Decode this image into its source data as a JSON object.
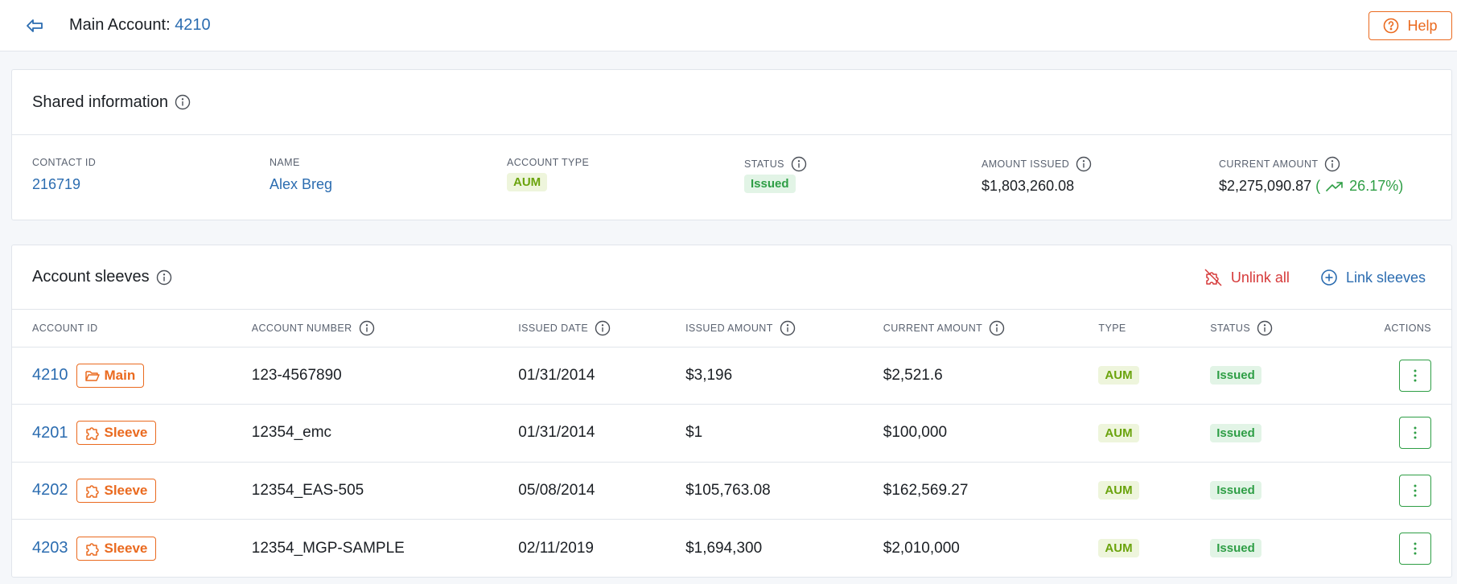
{
  "header": {
    "title_prefix": "Main Account: ",
    "account_number": "4210",
    "help_label": "Help"
  },
  "shared": {
    "title": "Shared information",
    "fields": {
      "contact_id": {
        "label": "CONTACT ID",
        "value": "216719"
      },
      "name": {
        "label": "NAME",
        "value": "Alex Breg"
      },
      "account_type": {
        "label": "ACCOUNT TYPE",
        "value": "AUM"
      },
      "status": {
        "label": "STATUS",
        "value": "Issued"
      },
      "amount_issued": {
        "label": "AMOUNT ISSUED",
        "value": "$1,803,260.08"
      },
      "current_amount": {
        "label": "CURRENT AMOUNT",
        "value": "$2,275,090.87",
        "pct_open": "(",
        "pct_value": "26.17%)"
      }
    }
  },
  "sleeves": {
    "title": "Account sleeves",
    "unlink_label": "Unlink all",
    "link_label": "Link sleeves",
    "columns": {
      "account_id": "ACCOUNT ID",
      "account_number": "ACCOUNT NUMBER",
      "issued_date": "ISSUED DATE",
      "issued_amount": "ISSUED AMOUNT",
      "current_amount": "CURRENT AMOUNT",
      "type": "TYPE",
      "status": "STATUS",
      "actions": "ACTIONS"
    },
    "rows": [
      {
        "id": "4210",
        "tag": "Main",
        "number": "123-4567890",
        "date": "01/31/2014",
        "issued": "$3,196",
        "current": "$2,521.6",
        "type": "AUM",
        "status": "Issued"
      },
      {
        "id": "4201",
        "tag": "Sleeve",
        "number": "12354_emc",
        "date": "01/31/2014",
        "issued": "$1",
        "current": "$100,000",
        "type": "AUM",
        "status": "Issued"
      },
      {
        "id": "4202",
        "tag": "Sleeve",
        "number": "12354_EAS-505",
        "date": "05/08/2014",
        "issued": "$105,763.08",
        "current": "$162,569.27",
        "type": "AUM",
        "status": "Issued"
      },
      {
        "id": "4203",
        "tag": "Sleeve",
        "number": "12354_MGP-SAMPLE",
        "date": "02/11/2019",
        "issued": "$1,694,300",
        "current": "$2,010,000",
        "type": "AUM",
        "status": "Issued"
      }
    ]
  },
  "colors": {
    "accent_blue": "#2b6cb0",
    "accent_orange": "#ea6a1f",
    "danger_red": "#d63a3a",
    "success_green": "#2e9e45",
    "aum_green": "#6aa30c"
  }
}
